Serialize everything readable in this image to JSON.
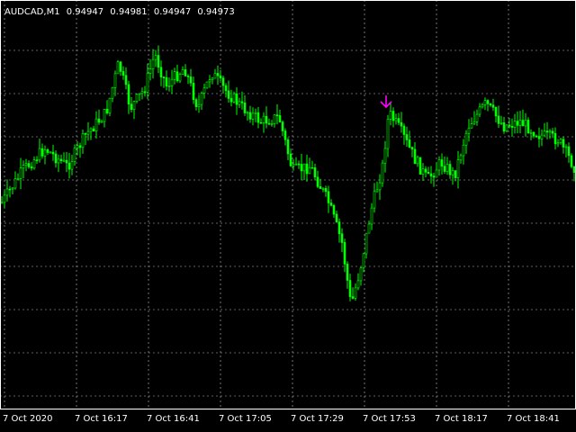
{
  "header": {
    "symbol_timeframe": "AUDCAD,M1",
    "open": "0.94947",
    "high": "0.94981",
    "low": "0.94947",
    "close": "0.94973"
  },
  "time_axis": {
    "labels": [
      "7 Oct 2020",
      "7 Oct 16:17",
      "7 Oct 16:41",
      "7 Oct 17:05",
      "7 Oct 17:29",
      "7 Oct 17:53",
      "7 Oct 18:17",
      "7 Oct 18:41"
    ]
  },
  "colors": {
    "background": "#000000",
    "candle": "#00ff00",
    "grid": "#c0c0c0",
    "arrow": "#ff00ff",
    "axis": "#ffffff"
  },
  "signal": {
    "type": "sell-arrow",
    "icon": "down-arrow-icon"
  }
}
